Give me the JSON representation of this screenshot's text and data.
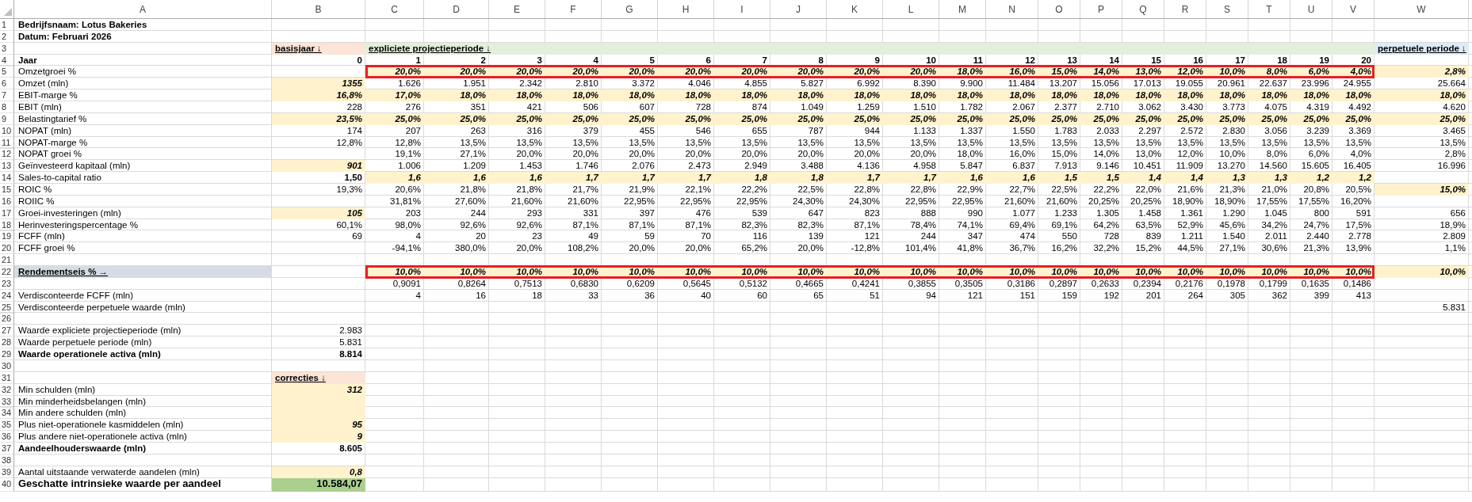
{
  "columns": [
    "A",
    "B",
    "C",
    "D",
    "E",
    "F",
    "G",
    "H",
    "I",
    "J",
    "K",
    "L",
    "M",
    "N",
    "O",
    "P",
    "Q",
    "R",
    "S",
    "T",
    "U",
    "V",
    "W"
  ],
  "rows": [
    {
      "n": "1",
      "kind": "title",
      "label": "Bedrijfsnaam: Lotus Bakeries"
    },
    {
      "n": "2",
      "kind": "title",
      "label": "Datum: Februari 2026"
    },
    {
      "n": "3",
      "kind": "band",
      "b": {
        "text": "basisjaar ↓",
        "color": "#fce4d6"
      },
      "span": {
        "text": "expliciete projectieperiode ↓",
        "color": "#e2efda"
      },
      "w": {
        "text": "perpetuele periode ↓",
        "color": "#ddebf7"
      }
    },
    {
      "n": "4",
      "kind": "year",
      "label": "Jaar",
      "b": {
        "text": "0"
      },
      "years": [
        "1",
        "2",
        "3",
        "4",
        "5",
        "6",
        "7",
        "8",
        "9",
        "10",
        "11",
        "12",
        "13",
        "14",
        "15",
        "16",
        "17",
        "18",
        "19",
        "20"
      ]
    },
    {
      "n": "5",
      "kind": "data",
      "label": "Omzetgroei %",
      "years": [
        "20,0%",
        "20,0%",
        "20,0%",
        "20,0%",
        "20,0%",
        "20,0%",
        "20,0%",
        "20,0%",
        "20,0%",
        "20,0%",
        "18,0%",
        "16,0%",
        "15,0%",
        "14,0%",
        "13,0%",
        "12,0%",
        "10,0%",
        "8,0%",
        "6,0%",
        "4,0%"
      ],
      "years_input": true,
      "w": {
        "text": "2,8%",
        "input": true
      },
      "highlighted": true
    },
    {
      "n": "6",
      "kind": "data",
      "label": "Omzet (mln)",
      "b": {
        "text": "1355",
        "input": true
      },
      "years": [
        "1.626",
        "1.951",
        "2.342",
        "2.810",
        "3.372",
        "4.046",
        "4.855",
        "5.827",
        "6.992",
        "8.390",
        "9.900",
        "11.484",
        "13.207",
        "15.056",
        "17.013",
        "19.055",
        "20.961",
        "22.637",
        "23.996",
        "24.955"
      ],
      "w": {
        "text": "25.664"
      }
    },
    {
      "n": "7",
      "kind": "data",
      "label": "EBIT-marge %",
      "b": {
        "text": "16,8%",
        "input": true
      },
      "years": [
        "17,0%",
        "18,0%",
        "18,0%",
        "18,0%",
        "18,0%",
        "18,0%",
        "18,0%",
        "18,0%",
        "18,0%",
        "18,0%",
        "18,0%",
        "18,0%",
        "18,0%",
        "18,0%",
        "18,0%",
        "18,0%",
        "18,0%",
        "18,0%",
        "18,0%",
        "18,0%"
      ],
      "years_input": true,
      "w": {
        "text": "18,0%",
        "input": true
      }
    },
    {
      "n": "8",
      "kind": "data",
      "label": "EBIT (mln)",
      "b": {
        "text": "228"
      },
      "years": [
        "276",
        "351",
        "421",
        "506",
        "607",
        "728",
        "874",
        "1.049",
        "1.259",
        "1.510",
        "1.782",
        "2.067",
        "2.377",
        "2.710",
        "3.062",
        "3.430",
        "3.773",
        "4.075",
        "4.319",
        "4.492"
      ],
      "w": {
        "text": "4.620"
      }
    },
    {
      "n": "9",
      "kind": "data",
      "label": "Belastingtarief %",
      "b": {
        "text": "23,5%",
        "input": true
      },
      "years": [
        "25,0%",
        "25,0%",
        "25,0%",
        "25,0%",
        "25,0%",
        "25,0%",
        "25,0%",
        "25,0%",
        "25,0%",
        "25,0%",
        "25,0%",
        "25,0%",
        "25,0%",
        "25,0%",
        "25,0%",
        "25,0%",
        "25,0%",
        "25,0%",
        "25,0%",
        "25,0%"
      ],
      "years_input": true,
      "w": {
        "text": "25,0%",
        "input": true
      }
    },
    {
      "n": "10",
      "kind": "data",
      "label": "NOPAT (mln)",
      "b": {
        "text": "174"
      },
      "years": [
        "207",
        "263",
        "316",
        "379",
        "455",
        "546",
        "655",
        "787",
        "944",
        "1.133",
        "1.337",
        "1.550",
        "1.783",
        "2.033",
        "2.297",
        "2.572",
        "2.830",
        "3.056",
        "3.239",
        "3.369"
      ],
      "w": {
        "text": "3.465"
      }
    },
    {
      "n": "11",
      "kind": "data",
      "label": "NOPAT-marge %",
      "b": {
        "text": "12,8%"
      },
      "years": [
        "12,8%",
        "13,5%",
        "13,5%",
        "13,5%",
        "13,5%",
        "13,5%",
        "13,5%",
        "13,5%",
        "13,5%",
        "13,5%",
        "13,5%",
        "13,5%",
        "13,5%",
        "13,5%",
        "13,5%",
        "13,5%",
        "13,5%",
        "13,5%",
        "13,5%",
        "13,5%"
      ],
      "w": {
        "text": "13,5%"
      }
    },
    {
      "n": "12",
      "kind": "data",
      "label": "NOPAT groei %",
      "years": [
        "19,1%",
        "27,1%",
        "20,0%",
        "20,0%",
        "20,0%",
        "20,0%",
        "20,0%",
        "20,0%",
        "20,0%",
        "20,0%",
        "18,0%",
        "16,0%",
        "15,0%",
        "14,0%",
        "13,0%",
        "12,0%",
        "10,0%",
        "8,0%",
        "6,0%",
        "4,0%"
      ],
      "w": {
        "text": "2,8%"
      }
    },
    {
      "n": "13",
      "kind": "data",
      "label": "Geïnvesteerd kapitaal (mln)",
      "b": {
        "text": "901",
        "input": true
      },
      "years": [
        "1.006",
        "1.209",
        "1.453",
        "1.746",
        "2.076",
        "2.473",
        "2.949",
        "3.488",
        "4.136",
        "4.958",
        "5.847",
        "6.837",
        "7.913",
        "9.146",
        "10.451",
        "11.909",
        "13.270",
        "14.560",
        "15.605",
        "16.405"
      ],
      "w": {
        "text": "16.996"
      }
    },
    {
      "n": "14",
      "kind": "data",
      "label": "Sales-to-capital ratio",
      "b": {
        "text": "1,50",
        "bold": true
      },
      "years": [
        "1,6",
        "1,6",
        "1,6",
        "1,7",
        "1,7",
        "1,7",
        "1,8",
        "1,8",
        "1,7",
        "1,7",
        "1,6",
        "1,6",
        "1,5",
        "1,5",
        "1,4",
        "1,4",
        "1,3",
        "1,3",
        "1,2",
        "1,2"
      ],
      "years_input": true
    },
    {
      "n": "15",
      "kind": "data",
      "label": "ROIC %",
      "b": {
        "text": "19,3%"
      },
      "years": [
        "20,6%",
        "21,8%",
        "21,8%",
        "21,7%",
        "21,9%",
        "22,1%",
        "22,2%",
        "22,5%",
        "22,8%",
        "22,8%",
        "22,9%",
        "22,7%",
        "22,5%",
        "22,2%",
        "22,0%",
        "21,6%",
        "21,3%",
        "21,0%",
        "20,8%",
        "20,5%"
      ],
      "w": {
        "text": "15,0%",
        "input": true
      }
    },
    {
      "n": "16",
      "kind": "data",
      "label": "ROIIC %",
      "years": [
        "31,81%",
        "27,60%",
        "21,60%",
        "21,60%",
        "22,95%",
        "22,95%",
        "22,95%",
        "24,30%",
        "24,30%",
        "22,95%",
        "22,95%",
        "21,60%",
        "21,60%",
        "20,25%",
        "20,25%",
        "18,90%",
        "18,90%",
        "17,55%",
        "17,55%",
        "16,20%"
      ]
    },
    {
      "n": "17",
      "kind": "data",
      "label": "Groei-investeringen (mln)",
      "b": {
        "text": "105",
        "input": true
      },
      "years": [
        "203",
        "244",
        "293",
        "331",
        "397",
        "476",
        "539",
        "647",
        "823",
        "888",
        "990",
        "1.077",
        "1.233",
        "1.305",
        "1.458",
        "1.361",
        "1.290",
        "1.045",
        "800",
        "591"
      ],
      "w": {
        "text": "656"
      }
    },
    {
      "n": "18",
      "kind": "data",
      "label": "Herinvesteringspercentage %",
      "b": {
        "text": "60,1%"
      },
      "years": [
        "98,0%",
        "92,6%",
        "92,6%",
        "87,1%",
        "87,1%",
        "87,1%",
        "82,3%",
        "82,3%",
        "87,1%",
        "78,4%",
        "74,1%",
        "69,4%",
        "69,1%",
        "64,2%",
        "63,5%",
        "52,9%",
        "45,6%",
        "34,2%",
        "24,7%",
        "17,5%"
      ],
      "w": {
        "text": "18,9%"
      }
    },
    {
      "n": "19",
      "kind": "data",
      "label": "FCFF (mln)",
      "b": {
        "text": "69"
      },
      "years": [
        "4",
        "20",
        "23",
        "49",
        "59",
        "70",
        "116",
        "139",
        "121",
        "244",
        "347",
        "474",
        "550",
        "728",
        "839",
        "1.211",
        "1.540",
        "2.011",
        "2.440",
        "2.778"
      ],
      "w": {
        "text": "2.809"
      }
    },
    {
      "n": "20",
      "kind": "data",
      "label": "FCFF groei %",
      "years": [
        "-94,1%",
        "380,0%",
        "20,0%",
        "108,2%",
        "20,0%",
        "20,0%",
        "65,2%",
        "20,0%",
        "-12,8%",
        "101,4%",
        "41,8%",
        "36,7%",
        "16,2%",
        "32,2%",
        "15,2%",
        "44,5%",
        "27,1%",
        "30,6%",
        "21,3%",
        "13,9%"
      ],
      "w": {
        "text": "1,1%"
      }
    },
    {
      "n": "21",
      "kind": "data"
    },
    {
      "n": "22",
      "kind": "rate",
      "label": "Rendementseis % →",
      "years": [
        "10,0%",
        "10,0%",
        "10,0%",
        "10,0%",
        "10,0%",
        "10,0%",
        "10,0%",
        "10,0%",
        "10,0%",
        "10,0%",
        "10,0%",
        "10,0%",
        "10,0%",
        "10,0%",
        "10,0%",
        "10,0%",
        "10,0%",
        "10,0%",
        "10,0%",
        "10,0%"
      ],
      "years_input": true,
      "w": {
        "text": "10,0%",
        "input": true
      },
      "highlighted": true
    },
    {
      "n": "23",
      "kind": "data",
      "years": [
        "0,9091",
        "0,8264",
        "0,7513",
        "0,6830",
        "0,6209",
        "0,5645",
        "0,5132",
        "0,4665",
        "0,4241",
        "0,3855",
        "0,3505",
        "0,3186",
        "0,2897",
        "0,2633",
        "0,2394",
        "0,2176",
        "0,1978",
        "0,1799",
        "0,1635",
        "0,1486"
      ]
    },
    {
      "n": "24",
      "kind": "data",
      "label": "Verdisconteerde FCFF (mln)",
      "years": [
        "4",
        "16",
        "18",
        "33",
        "36",
        "40",
        "60",
        "65",
        "51",
        "94",
        "121",
        "151",
        "159",
        "192",
        "201",
        "264",
        "305",
        "362",
        "399",
        "413"
      ]
    },
    {
      "n": "25",
      "kind": "data",
      "label": "Verdisconteerde perpetuele waarde (mln)",
      "w": {
        "text": "5.831"
      }
    },
    {
      "n": "26",
      "kind": "data"
    },
    {
      "n": "27",
      "kind": "data",
      "label": "Waarde expliciete projectieperiode (mln)",
      "b": {
        "text": "2.983"
      }
    },
    {
      "n": "28",
      "kind": "data",
      "label": "Waarde perpetuele periode (mln)",
      "b": {
        "text": "5.831"
      }
    },
    {
      "n": "29",
      "kind": "total",
      "label": "Waarde operationele activa (mln)",
      "b": {
        "text": "8.814"
      }
    },
    {
      "n": "30",
      "kind": "data"
    },
    {
      "n": "31",
      "kind": "band",
      "b": {
        "text": "correcties ↓",
        "color": "#fce4d6"
      }
    },
    {
      "n": "32",
      "kind": "data",
      "label": "Min schulden (mln)",
      "b": {
        "text": "312",
        "input": true
      }
    },
    {
      "n": "33",
      "kind": "data",
      "label": "Min minderheidsbelangen (mln)",
      "b": {
        "input": true
      }
    },
    {
      "n": "34",
      "kind": "data",
      "label": "Min andere schulden (mln)",
      "b": {
        "input": true
      }
    },
    {
      "n": "35",
      "kind": "data",
      "label": "Plus niet-operationele kasmiddelen (mln)",
      "b": {
        "text": "95",
        "input": true
      }
    },
    {
      "n": "36",
      "kind": "data",
      "label": "Plus andere niet-operationele activa (mln)",
      "b": {
        "text": "9",
        "input": true
      }
    },
    {
      "n": "37",
      "kind": "total",
      "label": "Aandeelhouderswaarde (mln)",
      "b": {
        "text": "8.605"
      }
    },
    {
      "n": "38",
      "kind": "data"
    },
    {
      "n": "39",
      "kind": "data",
      "label": "Aantal uitstaande verwaterde aandelen (mln)",
      "b": {
        "text": "0,8",
        "input": true
      }
    },
    {
      "n": "40",
      "kind": "result",
      "label": "Geschatte intrinsieke waarde per aandeel",
      "b": {
        "text": "10.584,07",
        "color": "#a9d08e"
      }
    }
  ]
}
